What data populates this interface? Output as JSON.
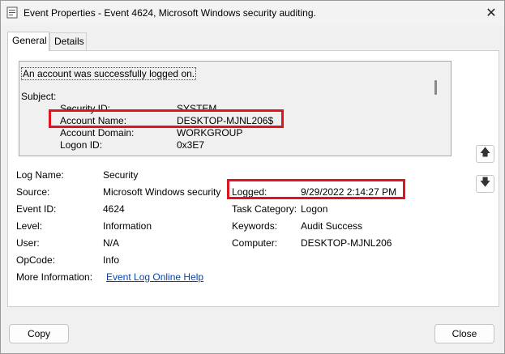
{
  "window": {
    "title": "Event Properties - Event 4624, Microsoft Windows security auditing.",
    "close_glyph": "✕"
  },
  "tabs": [
    {
      "label": "General",
      "active": true
    },
    {
      "label": "Details",
      "active": false
    }
  ],
  "description": {
    "summary": "An account was successfully logged on.",
    "subject_heading": "Subject:",
    "rows": [
      {
        "label": "Security ID:",
        "value": "SYSTEM"
      },
      {
        "label": "Account Name:",
        "value": "DESKTOP-MJNL206$"
      },
      {
        "label": "Account Domain:",
        "value": "WORKGROUP"
      },
      {
        "label": "Logon ID:",
        "value": "0x3E7"
      }
    ]
  },
  "fields": {
    "log_name": {
      "label": "Log Name:",
      "value": "Security"
    },
    "source": {
      "label": "Source:",
      "value": "Microsoft Windows security"
    },
    "logged": {
      "label": "Logged:",
      "value": "9/29/2022 2:14:27 PM"
    },
    "event_id": {
      "label": "Event ID:",
      "value": "4624"
    },
    "task_category": {
      "label": "Task Category:",
      "value": "Logon"
    },
    "level": {
      "label": "Level:",
      "value": "Information"
    },
    "keywords": {
      "label": "Keywords:",
      "value": "Audit Success"
    },
    "user": {
      "label": "User:",
      "value": "N/A"
    },
    "computer": {
      "label": "Computer:",
      "value": "DESKTOP-MJNL206"
    },
    "opcode": {
      "label": "OpCode:",
      "value": "Info"
    },
    "more_info": {
      "label": "More Information:",
      "link": "Event Log Online Help"
    }
  },
  "nav": {
    "up_glyph": "🡅",
    "down_glyph": "🡇"
  },
  "buttons": {
    "copy": "Copy",
    "close": "Close"
  },
  "colors": {
    "highlight": "#e0141e",
    "link": "#0645ad"
  }
}
